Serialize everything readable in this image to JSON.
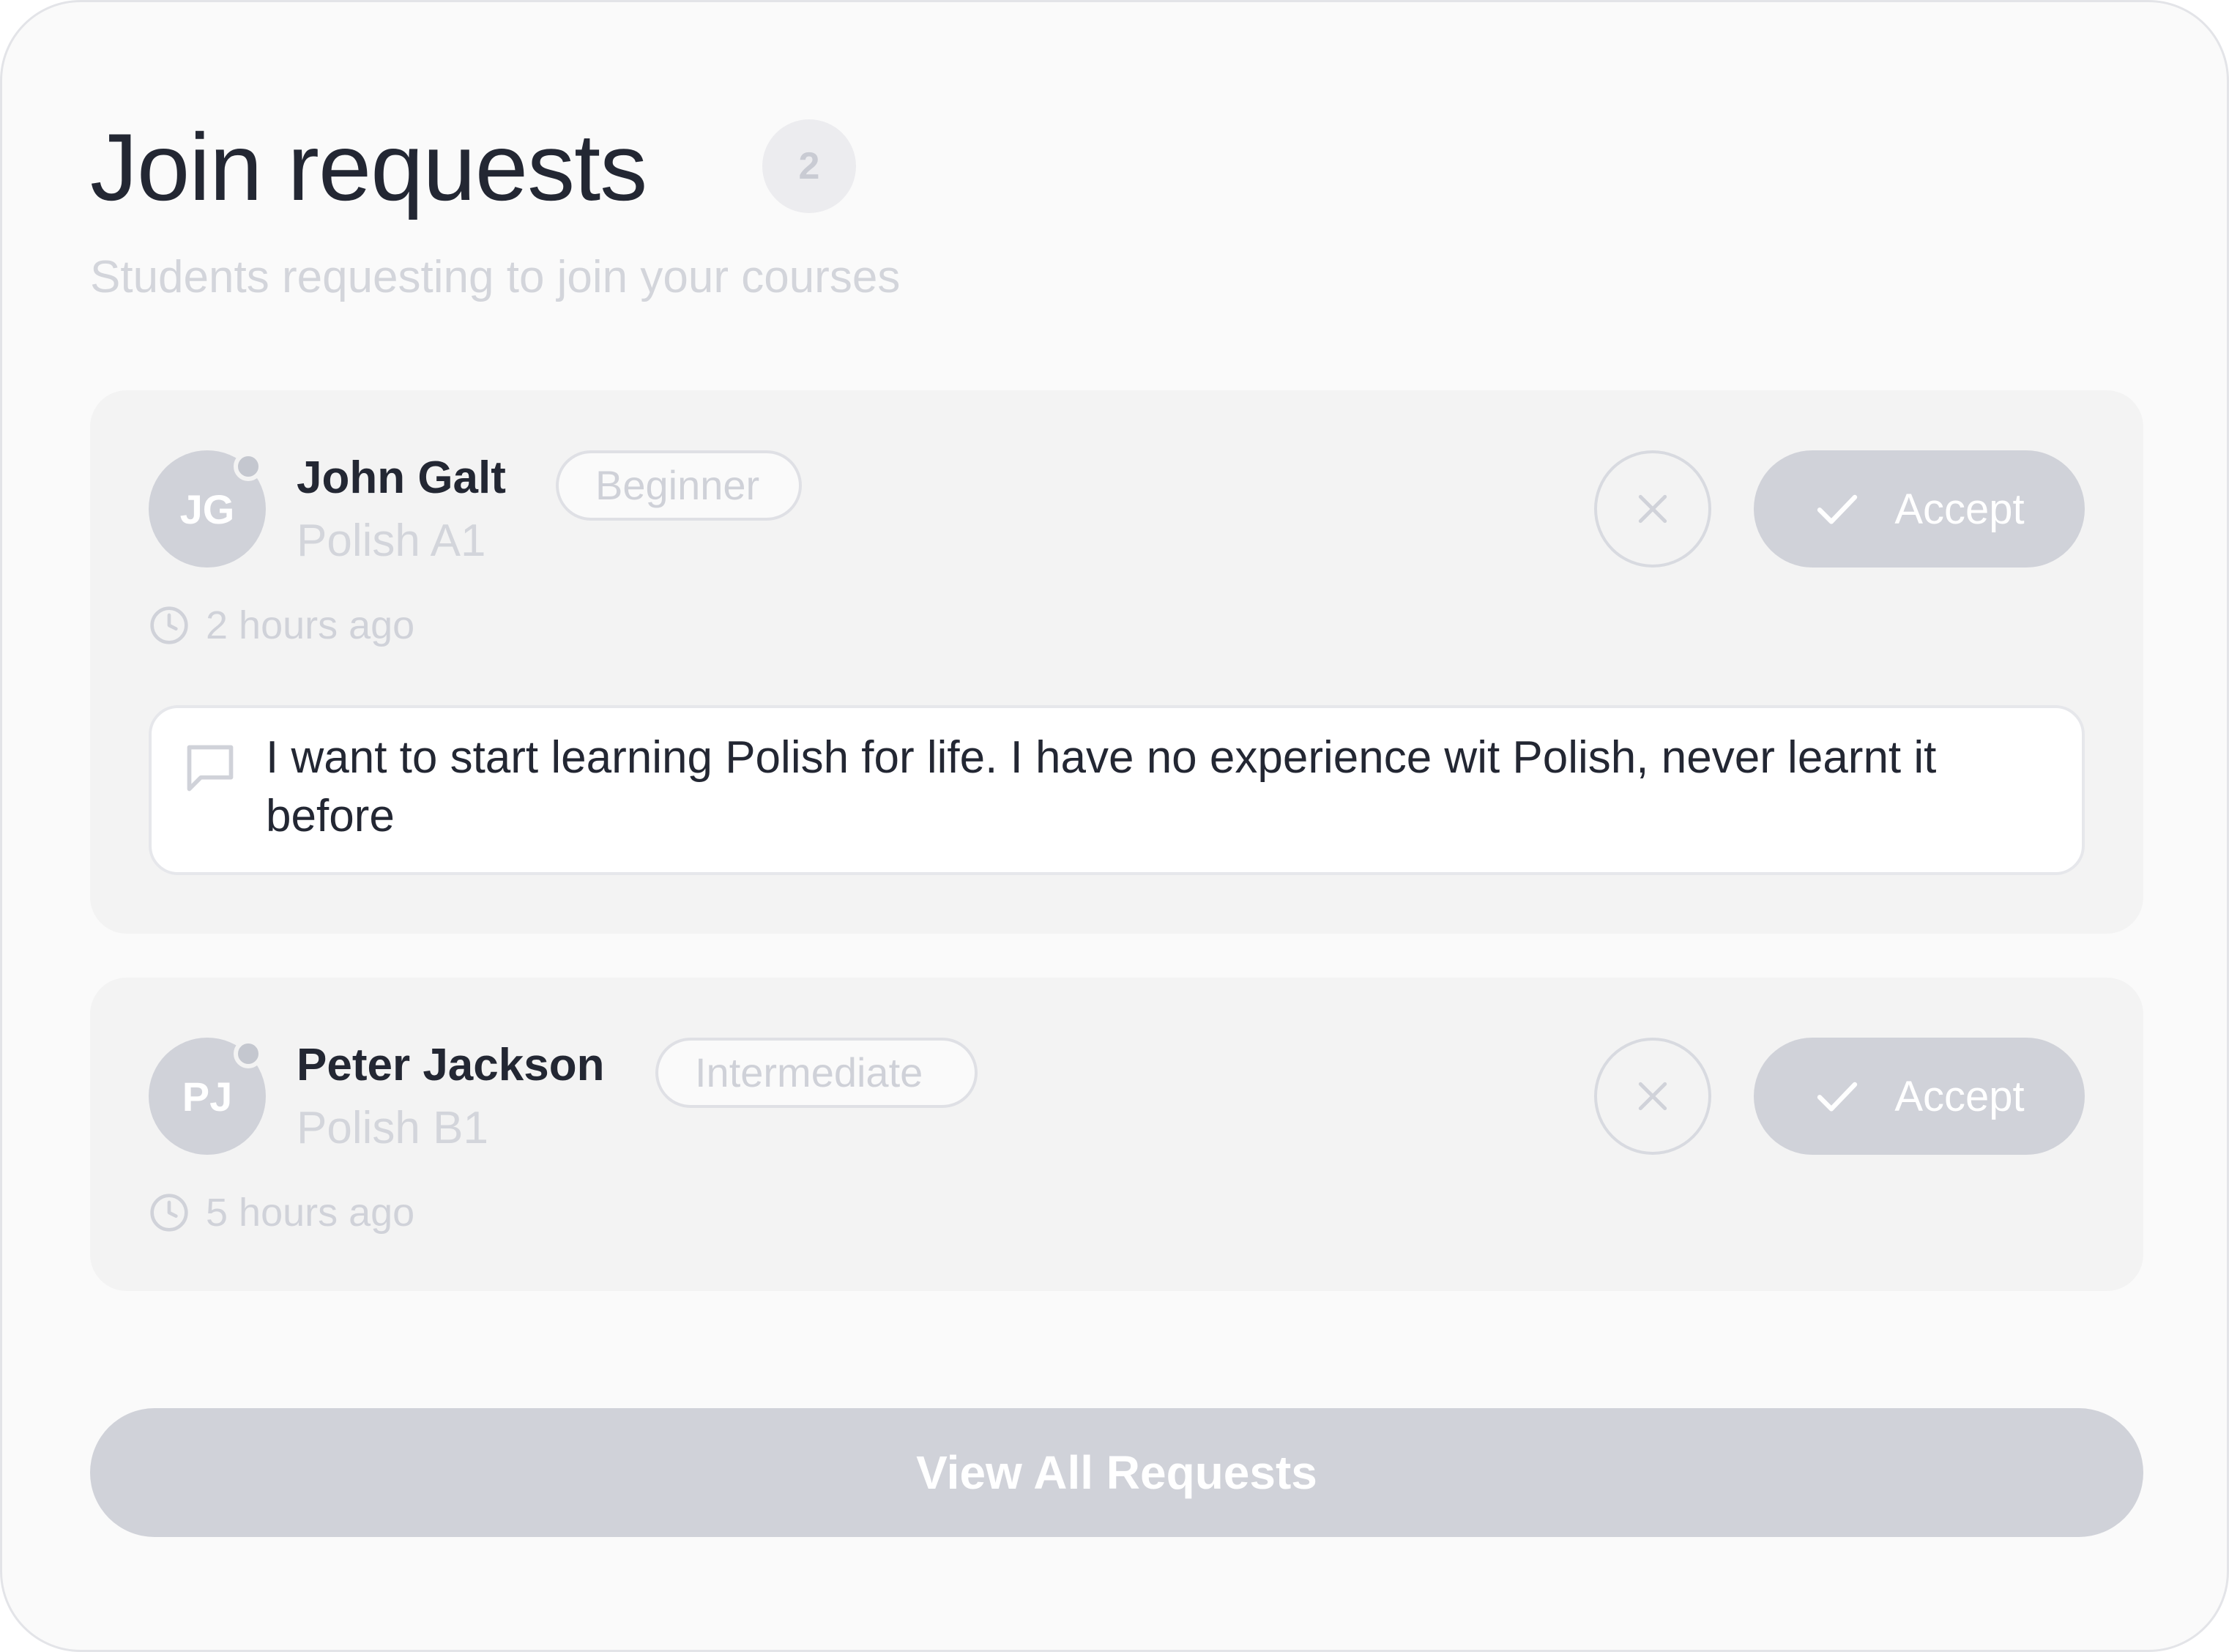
{
  "header": {
    "title": "Join requests",
    "count": "2",
    "subtitle": "Students requesting to join your courses"
  },
  "requests": [
    {
      "initials": "JG",
      "name": "John Galt",
      "level": "Beginner",
      "course": "Polish A1",
      "time": "2 hours ago",
      "message": "I want to start learning Polish for life. I have no experience wit Polish, never learnt it before",
      "accept_label": "Accept"
    },
    {
      "initials": "PJ",
      "name": "Peter Jackson",
      "level": "Intermediate",
      "course": "Polish B1",
      "time": "5 hours ago",
      "accept_label": "Accept"
    }
  ],
  "footer": {
    "view_all_label": "View All Requests"
  },
  "colors": {
    "text_primary": "#232733",
    "muted": "#d0d2d9",
    "card_bg": "#f3f3f3",
    "page_bg": "#fafafa"
  },
  "icons": {
    "clock": "clock-icon",
    "close": "close-icon",
    "check": "check-icon",
    "message": "message-icon"
  }
}
